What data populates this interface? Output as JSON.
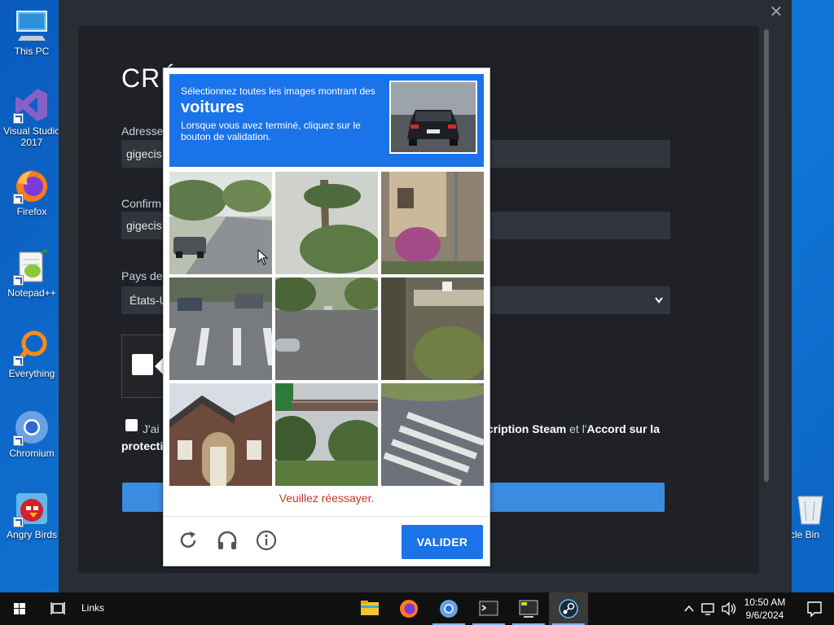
{
  "desktop": {
    "icons": [
      {
        "label": "This PC"
      },
      {
        "label": "Visual Studio 2017"
      },
      {
        "label": "Firefox"
      },
      {
        "label": "Notepad++"
      },
      {
        "label": "Everything"
      },
      {
        "label": "Chromium"
      },
      {
        "label": "Angry Birds"
      },
      {
        "label": "cle Bin"
      }
    ]
  },
  "steam": {
    "close_glyph": "✕",
    "title": "CRÉ",
    "email_label": "Adresse",
    "email_value": "gigecis",
    "confirm_label": "Confirm",
    "confirm_value": "gigecis",
    "country_label": "Pays de",
    "country_value": "États-U",
    "agree_prefix": "J'ai",
    "agree_link1": "cription Steam",
    "agree_mid": " et l'",
    "agree_link2": "Accord sur la",
    "agree_line2": "protecti"
  },
  "recaptcha": {
    "instruction_line1": "Sélectionnez toutes les images montrant des",
    "keyword": "voitures",
    "instruction_line3": "Lorsque vous avez terminé, cliquez sur le bouton de validation.",
    "error_text": "Veuillez réessayer.",
    "verify_label": "VALIDER",
    "colors": {
      "accent": "#1a73e8",
      "error": "#c0392b"
    },
    "footer_icons": [
      "reload-icon",
      "headphones-icon",
      "info-icon"
    ]
  },
  "taskbar": {
    "links_label": "Links",
    "time": "10:50 AM",
    "date": "9/6/2024"
  }
}
